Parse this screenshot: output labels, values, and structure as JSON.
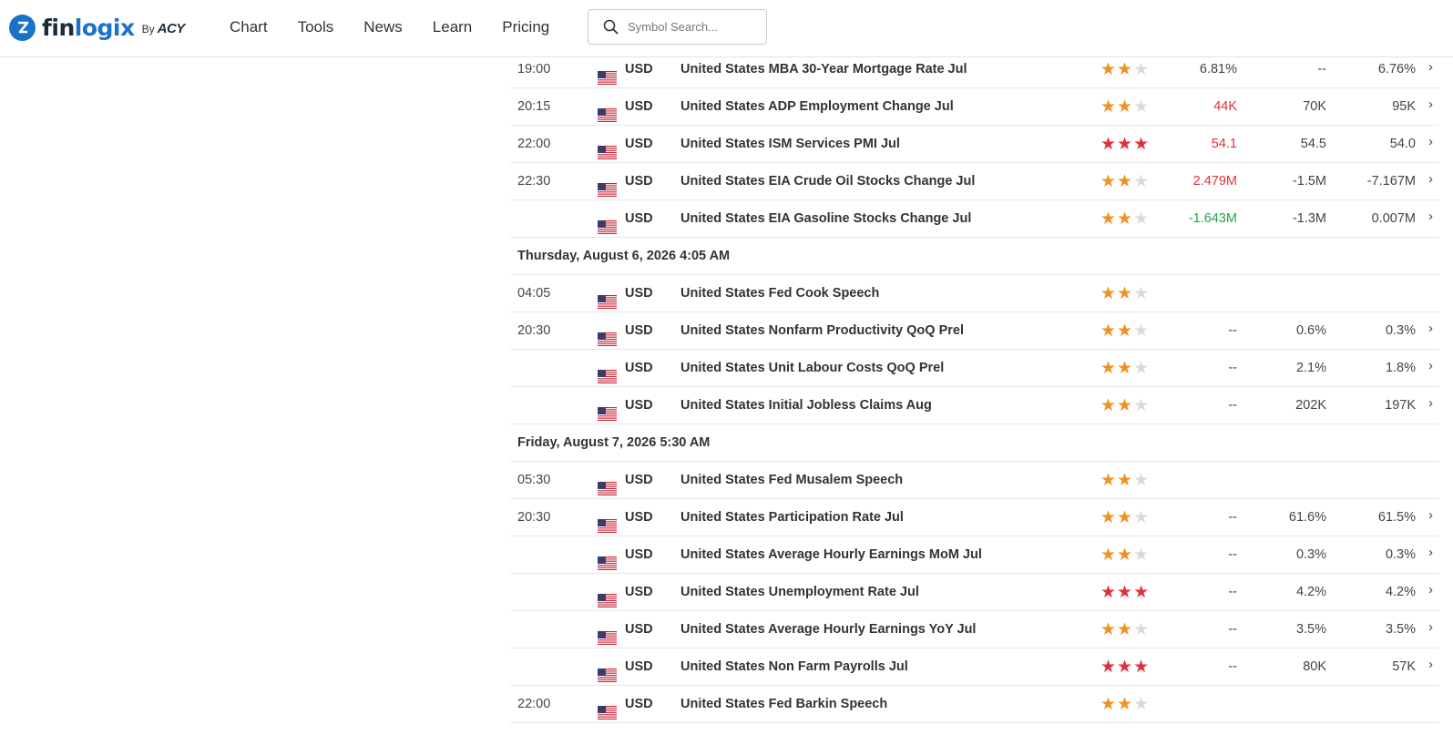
{
  "header": {
    "logo_text_a": "fin",
    "logo_text_b": "logix",
    "logo_by": "By",
    "logo_acy": "ACY",
    "nav": [
      "Chart",
      "Tools",
      "News",
      "Learn",
      "Pricing"
    ],
    "search_placeholder": "Symbol Search..."
  },
  "colors": {
    "brand": "#1a73c9",
    "actual_negative": "#e0313b",
    "actual_positive": "#1fa54a",
    "star_medium": "#f0921f",
    "star_high": "#e0313b"
  },
  "rows": [
    {
      "type": "event",
      "time": "19:00",
      "currency": "USD",
      "event": "United States MBA 30-Year Mortgage Rate Jul",
      "impact": "medium",
      "actual": "6.81%",
      "actual_color": "plain",
      "forecast": "--",
      "previous": "6.76%",
      "chevron": true
    },
    {
      "type": "event",
      "time": "20:15",
      "currency": "USD",
      "event": "United States ADP Employment Change Jul",
      "impact": "medium",
      "actual": "44K",
      "actual_color": "red",
      "forecast": "70K",
      "previous": "95K",
      "chevron": true
    },
    {
      "type": "event",
      "time": "22:00",
      "currency": "USD",
      "event": "United States ISM Services PMI Jul",
      "impact": "high",
      "actual": "54.1",
      "actual_color": "red",
      "forecast": "54.5",
      "previous": "54.0",
      "chevron": true
    },
    {
      "type": "event",
      "time": "22:30",
      "currency": "USD",
      "event": "United States EIA Crude Oil Stocks Change Jul",
      "impact": "medium",
      "actual": "2.479M",
      "actual_color": "red",
      "forecast": "-1.5M",
      "previous": "-7.167M",
      "chevron": true
    },
    {
      "type": "event",
      "time": "",
      "currency": "USD",
      "event": "United States EIA Gasoline Stocks Change Jul",
      "impact": "medium",
      "actual": "-1.643M",
      "actual_color": "green",
      "forecast": "-1.3M",
      "previous": "0.007M",
      "chevron": true
    },
    {
      "type": "date",
      "label": "Thursday, August 6, 2026 4:05 AM"
    },
    {
      "type": "event",
      "time": "04:05",
      "currency": "USD",
      "event": "United States Fed Cook Speech",
      "impact": "medium",
      "actual": "",
      "actual_color": "plain",
      "forecast": "",
      "previous": "",
      "chevron": false
    },
    {
      "type": "event",
      "time": "20:30",
      "currency": "USD",
      "event": "United States Nonfarm Productivity QoQ Prel",
      "impact": "medium",
      "actual": "--",
      "actual_color": "plain",
      "forecast": "0.6%",
      "previous": "0.3%",
      "chevron": true
    },
    {
      "type": "event",
      "time": "",
      "currency": "USD",
      "event": "United States Unit Labour Costs QoQ Prel",
      "impact": "medium",
      "actual": "--",
      "actual_color": "plain",
      "forecast": "2.1%",
      "previous": "1.8%",
      "chevron": true
    },
    {
      "type": "event",
      "time": "",
      "currency": "USD",
      "event": "United States Initial Jobless Claims Aug",
      "impact": "medium",
      "actual": "--",
      "actual_color": "plain",
      "forecast": "202K",
      "previous": "197K",
      "chevron": true
    },
    {
      "type": "date",
      "label": "Friday, August 7, 2026 5:30 AM"
    },
    {
      "type": "event",
      "time": "05:30",
      "currency": "USD",
      "event": "United States Fed Musalem Speech",
      "impact": "medium",
      "actual": "",
      "actual_color": "plain",
      "forecast": "",
      "previous": "",
      "chevron": false
    },
    {
      "type": "event",
      "time": "20:30",
      "currency": "USD",
      "event": "United States Participation Rate Jul",
      "impact": "medium",
      "actual": "--",
      "actual_color": "plain",
      "forecast": "61.6%",
      "previous": "61.5%",
      "chevron": true
    },
    {
      "type": "event",
      "time": "",
      "currency": "USD",
      "event": "United States Average Hourly Earnings MoM Jul",
      "impact": "medium",
      "actual": "--",
      "actual_color": "plain",
      "forecast": "0.3%",
      "previous": "0.3%",
      "chevron": true
    },
    {
      "type": "event",
      "time": "",
      "currency": "USD",
      "event": "United States Unemployment Rate Jul",
      "impact": "high",
      "actual": "--",
      "actual_color": "plain",
      "forecast": "4.2%",
      "previous": "4.2%",
      "chevron": true
    },
    {
      "type": "event",
      "time": "",
      "currency": "USD",
      "event": "United States Average Hourly Earnings YoY Jul",
      "impact": "medium",
      "actual": "--",
      "actual_color": "plain",
      "forecast": "3.5%",
      "previous": "3.5%",
      "chevron": true
    },
    {
      "type": "event",
      "time": "",
      "currency": "USD",
      "event": "United States Non Farm Payrolls Jul",
      "impact": "high",
      "actual": "--",
      "actual_color": "plain",
      "forecast": "80K",
      "previous": "57K",
      "chevron": true
    },
    {
      "type": "event",
      "time": "22:00",
      "currency": "USD",
      "event": "United States Fed Barkin Speech",
      "impact": "medium",
      "actual": "",
      "actual_color": "plain",
      "forecast": "",
      "previous": "",
      "chevron": false
    }
  ]
}
